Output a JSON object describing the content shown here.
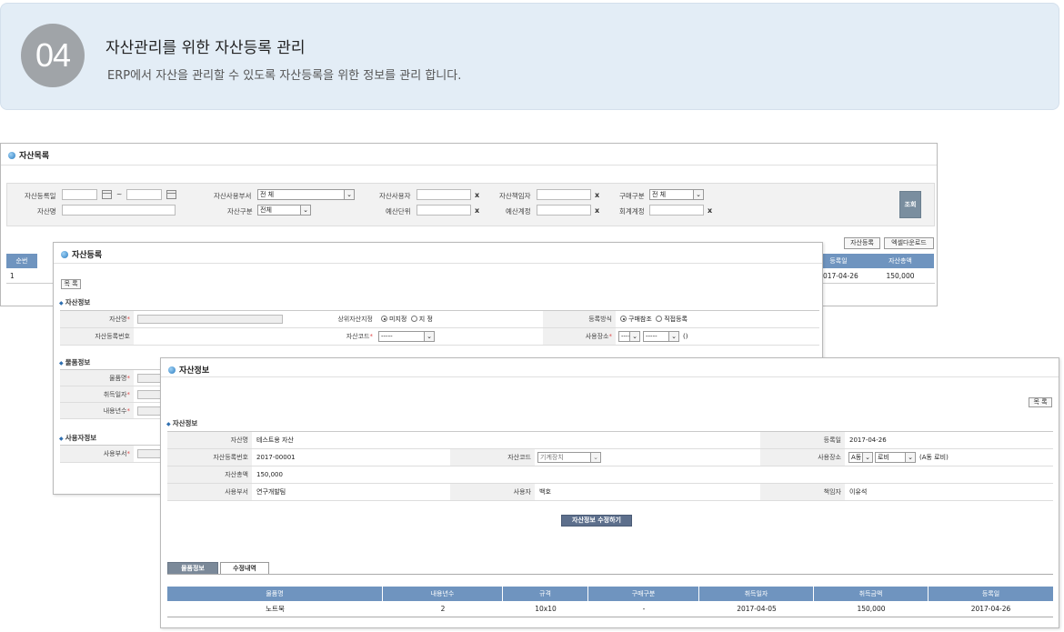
{
  "banner": {
    "number": "04",
    "title": "자산관리를 위한 자산등록 관리",
    "subtitle": "ERP에서 자산을 관리할 수 있도록 자산등록을 위한 정보를 관리 합니다."
  },
  "list_window": {
    "title": "자산목록",
    "filters": {
      "reg_date": "자산등록일",
      "tilde": "~",
      "asset_dept": "자산사용부서",
      "asset_dept_value": "전 체",
      "asset_user": "자산사용자",
      "asset_manager": "자산책임자",
      "purchase_type": "구매구분",
      "purchase_type_value": "전 체",
      "asset_name": "자산명",
      "asset_type": "자산구분",
      "asset_type_value": "전체",
      "budget_unit": "예산단위",
      "budget_account": "예산계정",
      "accounting_account": "회계계정",
      "x": "x"
    },
    "search_button": "조회",
    "register_button": "자산등록",
    "excel_button": "엑셀다운로드",
    "table": {
      "headers": [
        "순번",
        "등록일",
        "자산총액"
      ],
      "row": [
        "1",
        "2017-04-26",
        "150,000"
      ]
    }
  },
  "register_window": {
    "title": "자산등록",
    "list_button": "목 록",
    "section_asset": "자산정보",
    "asset_name_label": "자산명",
    "upper_asset_label": "상위자산지정",
    "radio_none": "미지정",
    "radio_set": "지 정",
    "reg_method_label": "등록방식",
    "radio_purchase": "구매참조",
    "radio_direct": "직접등록",
    "reg_no_label": "자산등록번호",
    "asset_code_label": "자산코드",
    "asset_code_value": "-----",
    "location_label": "사용장소",
    "location_value1": "-----",
    "location_value2": "-----",
    "location_paren": "()",
    "section_item": "물품정보",
    "item_name_label": "물품명",
    "acq_date_label": "취득일자",
    "life_label": "내용년수",
    "section_user": "사용자정보",
    "dept_label": "사용부서",
    "required_mark": "*"
  },
  "info_window": {
    "title": "자산정보",
    "list_button": "목 록",
    "section": "자산정보",
    "fields": {
      "asset_name_label": "자산명",
      "asset_name": "테스트용 자산",
      "reg_date_label": "등록일",
      "reg_date": "2017-04-26",
      "reg_no_label": "자산등록번호",
      "reg_no": "2017-00001",
      "code_label": "자산코드",
      "code_value": "기계장치",
      "location_label": "사용장소",
      "location_a": "A동",
      "location_b": "로비",
      "location_text": "(A동 로비)",
      "total_label": "자산총액",
      "total": "150,000",
      "dept_label": "사용부서",
      "dept": "연구개발팀",
      "user_label": "사용자",
      "user": "백호",
      "manager_label": "책임자",
      "manager": "이유석"
    },
    "edit_button": "자산정보 수정하기",
    "tabs": [
      "물품정보",
      "수정내역"
    ],
    "table": {
      "headers": [
        "물품명",
        "내용년수",
        "규격",
        "구매구분",
        "취득일자",
        "취득금액",
        "등록일"
      ],
      "rows": [
        [
          "노트북",
          "2",
          "10x10",
          "-",
          "2017-04-05",
          "150,000",
          "2017-04-26"
        ]
      ]
    }
  }
}
